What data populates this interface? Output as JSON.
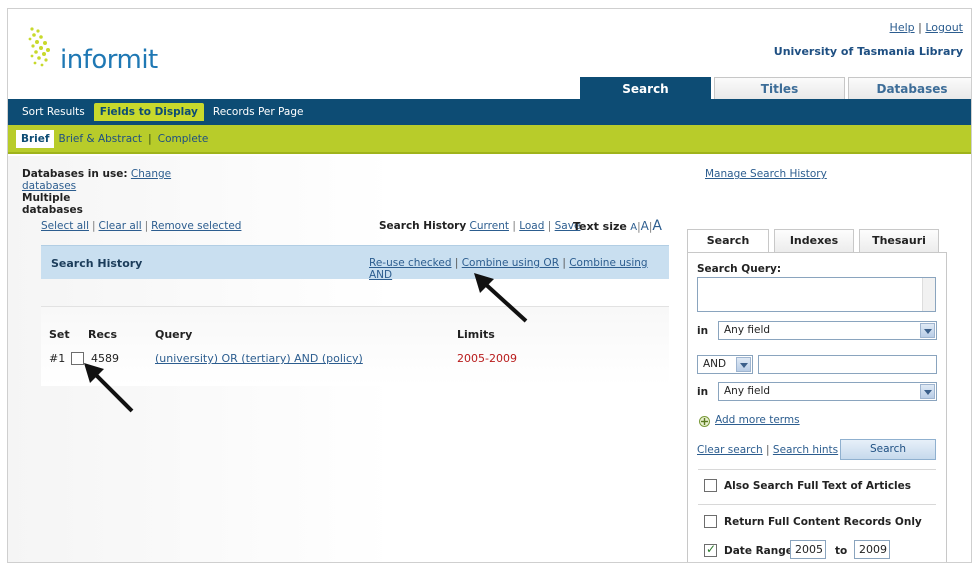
{
  "header": {
    "logo_text": "informit",
    "help_label": "Help",
    "logout_label": "Logout",
    "library": "University of Tasmania Library"
  },
  "main_tabs": [
    {
      "label": "Search",
      "active": true
    },
    {
      "label": "Titles",
      "active": false
    },
    {
      "label": "Databases",
      "active": false
    }
  ],
  "nav": [
    {
      "label": "Sort Results",
      "active": false
    },
    {
      "label": "Fields to Display",
      "active": true
    },
    {
      "label": "Records Per Page",
      "active": false
    }
  ],
  "subnav": {
    "brief": "Brief",
    "brief_abstract": "Brief & Abstract",
    "complete": "Complete"
  },
  "databases": {
    "label": "Databases in use:",
    "change_link": "Change databases",
    "value": "Multiple databases"
  },
  "manage_history": "Manage Search History",
  "selection": {
    "select_all": "Select all",
    "clear_all": "Clear all",
    "remove_selected": "Remove selected"
  },
  "history_links": {
    "label": "Search History",
    "current": "Current",
    "load": "Load",
    "save": "Save"
  },
  "text_size": {
    "label": "Text size",
    "small": "A",
    "medium": "A",
    "large": "A"
  },
  "history_bar": {
    "title": "Search History",
    "reuse": "Re-use checked",
    "combine_or": "Combine using OR",
    "combine_and": "Combine using AND"
  },
  "results": {
    "columns": [
      "Set",
      "Recs",
      "Query",
      "Limits"
    ],
    "rows": [
      {
        "set": "#1",
        "recs": "4589",
        "query": "(university) OR (tertiary) AND (policy)",
        "limits": "2005-2009",
        "checked": false
      }
    ]
  },
  "right_panel": {
    "tabs": [
      {
        "label": "Search",
        "active": true
      },
      {
        "label": "Indexes",
        "active": false
      },
      {
        "label": "Thesauri",
        "active": false
      }
    ],
    "query_label": "Search Query:",
    "query_value": "",
    "in_label": "in",
    "field1": "Any field",
    "operator": "AND",
    "term2": "",
    "field2": "Any field",
    "add_more": "Add more terms",
    "clear_search": "Clear search",
    "search_hints": "Search hints",
    "search_button": "Search",
    "full_text": {
      "label": "Also Search Full Text of Articles",
      "checked": false
    },
    "full_content": {
      "label": "Return Full Content Records Only",
      "checked": false
    },
    "date_range": {
      "label": "Date Range:",
      "checked": true,
      "from": "2005",
      "to_label": "to",
      "to": "2009"
    }
  },
  "colors": {
    "navy": "#0d4c74",
    "lime": "#b8cc2a",
    "link": "#2c5d8f",
    "limits": "#b81b1b"
  }
}
